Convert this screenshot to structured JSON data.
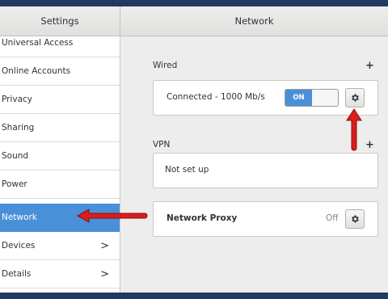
{
  "header": {
    "left_title": "Settings",
    "right_title": "Network"
  },
  "sidebar": {
    "items": [
      {
        "label": "Universal Access"
      },
      {
        "label": "Online Accounts"
      },
      {
        "label": "Privacy"
      },
      {
        "label": "Sharing"
      },
      {
        "label": "Sound"
      },
      {
        "label": "Power"
      },
      {
        "label": "Network",
        "selected": true
      },
      {
        "label": "Devices",
        "chevron": ">"
      },
      {
        "label": "Details",
        "chevron": ">"
      }
    ]
  },
  "wired": {
    "title": "Wired",
    "add_label": "+",
    "status": "Connected - 1000 Mb/s",
    "switch_label": "ON",
    "switch_on": true,
    "gear_icon": "gear-icon"
  },
  "vpn": {
    "title": "VPN",
    "add_label": "+",
    "status": "Not set up"
  },
  "proxy": {
    "label": "Network Proxy",
    "status": "Off",
    "gear_icon": "gear-icon"
  },
  "colors": {
    "accent": "#4a90d9",
    "annotation_arrow": "#d81e1e"
  }
}
